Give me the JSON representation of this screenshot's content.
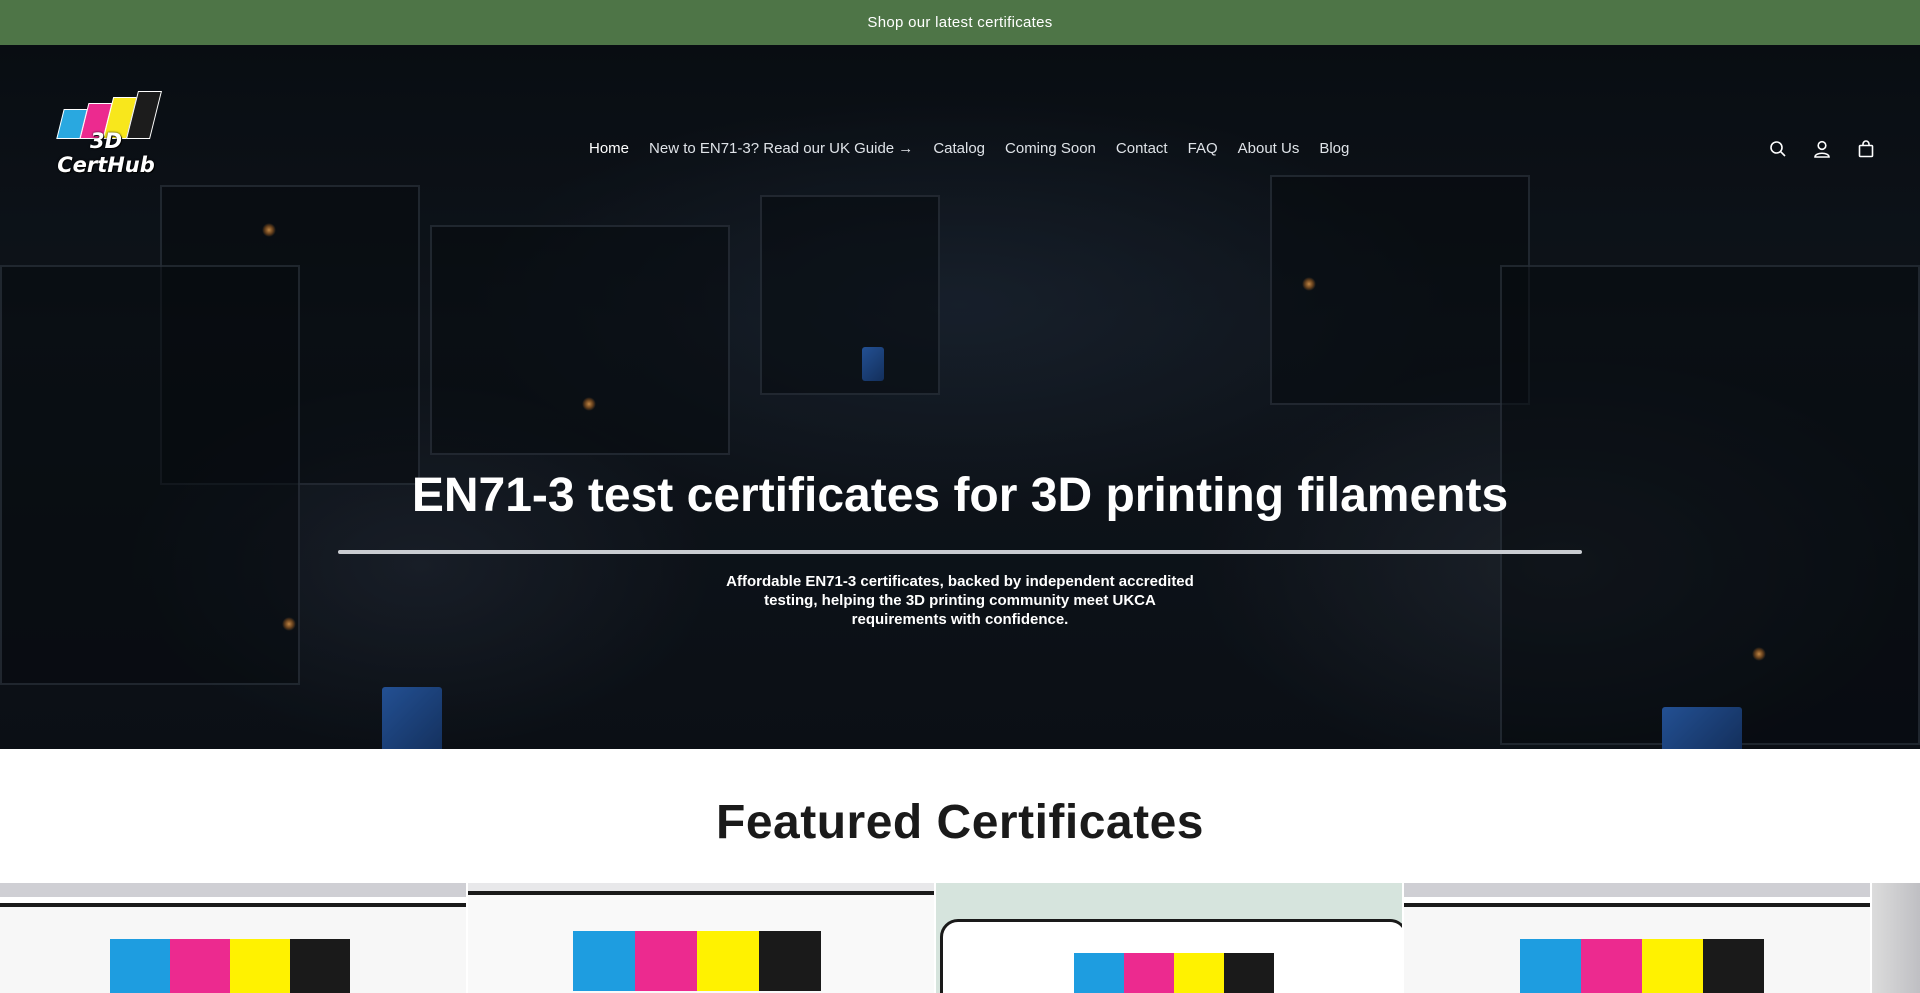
{
  "announcement": {
    "text": "Shop our latest certificates"
  },
  "logo": {
    "text": "3D CertHub",
    "bar_colors": [
      "#29a8e0",
      "#ec2a8f",
      "#f8e71c",
      "#1c1c1c"
    ]
  },
  "nav": {
    "items": [
      {
        "label": "Home",
        "active": true
      },
      {
        "label": "New to EN71-3? Read our UK Guide →",
        "active": false
      },
      {
        "label": "Catalog",
        "active": false
      },
      {
        "label": "Coming Soon",
        "active": false
      },
      {
        "label": "Contact",
        "active": false
      },
      {
        "label": "FAQ",
        "active": false
      },
      {
        "label": "About Us",
        "active": false
      },
      {
        "label": "Blog",
        "active": false
      }
    ]
  },
  "header_icons": [
    "search-icon",
    "account-icon",
    "cart-icon"
  ],
  "hero": {
    "title": "EN71-3 test certificates for 3D printing filaments",
    "subtitle": "Affordable EN71-3 certificates, backed by independent accredited testing, helping the 3D printing community meet UKCA requirements with confidence."
  },
  "featured": {
    "title": "Featured Certificates"
  },
  "colors": {
    "announcement_bg": "#4e7547",
    "swatch": [
      "#1e9de0",
      "#ec2a8f",
      "#fff200",
      "#1a1a1a"
    ]
  }
}
